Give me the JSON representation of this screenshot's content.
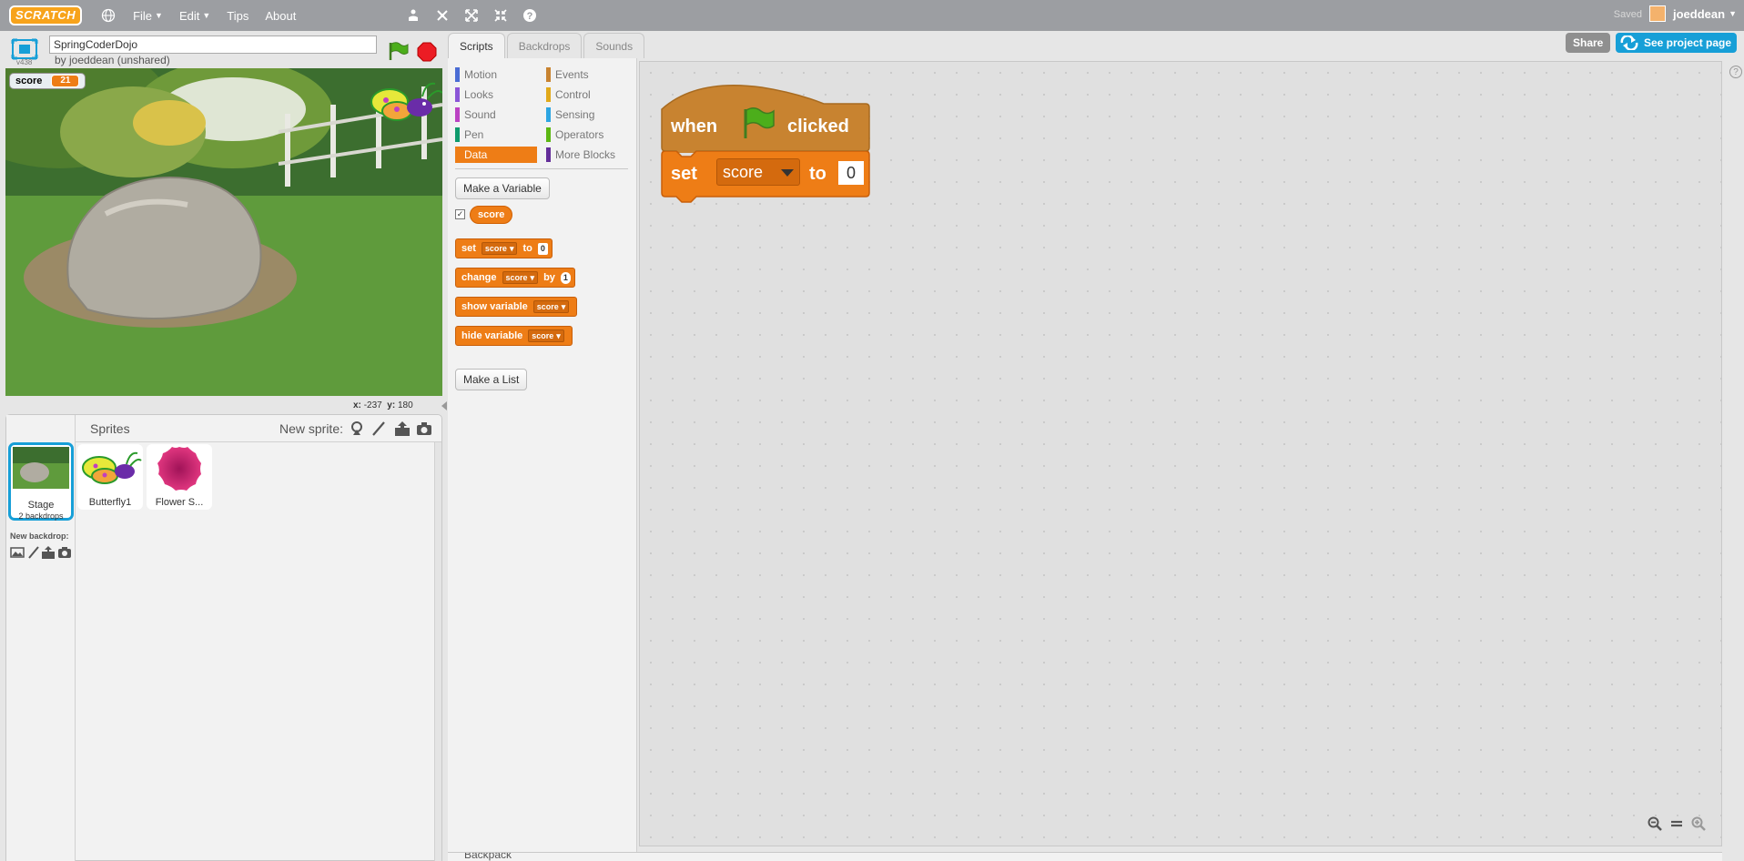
{
  "menubar": {
    "logo": "SCRATCH",
    "menus": [
      {
        "label": "File",
        "dropdown": true
      },
      {
        "label": "Edit",
        "dropdown": true
      },
      {
        "label": "Tips",
        "dropdown": false
      },
      {
        "label": "About",
        "dropdown": false
      }
    ],
    "tools": [
      "duplicate-icon",
      "delete-icon",
      "grow-icon",
      "shrink-icon",
      "help-icon"
    ],
    "save_status": "Saved",
    "username": "joeddean"
  },
  "stage_header": {
    "project_title": "SpringCoderDojo",
    "byline": "by joeddean (unshared)",
    "version": "v438"
  },
  "stage": {
    "monitor": {
      "label": "score",
      "value": "21"
    },
    "mouse_x_label": "x:",
    "mouse_x": "-237",
    "mouse_y_label": "y:",
    "mouse_y": "180"
  },
  "sprites": {
    "title": "Sprites",
    "new_sprite_label": "New sprite:",
    "stage_item": {
      "label": "Stage",
      "sublabel": "2 backdrops"
    },
    "new_backdrop_label": "New backdrop:",
    "items": [
      {
        "name": "Butterfly1"
      },
      {
        "name": "Flower S..."
      }
    ]
  },
  "tabs": [
    {
      "label": "Scripts",
      "active": true
    },
    {
      "label": "Backdrops",
      "active": false
    },
    {
      "label": "Sounds",
      "active": false
    }
  ],
  "palette": {
    "categories": [
      {
        "label": "Motion",
        "color": "#4a6cd4"
      },
      {
        "label": "Events",
        "color": "#c88330"
      },
      {
        "label": "Looks",
        "color": "#8a55d7"
      },
      {
        "label": "Control",
        "color": "#e1a91a"
      },
      {
        "label": "Sound",
        "color": "#bb42c3"
      },
      {
        "label": "Sensing",
        "color": "#2ca5e2"
      },
      {
        "label": "Pen",
        "color": "#0e9a6c"
      },
      {
        "label": "Operators",
        "color": "#5cb712"
      },
      {
        "label": "Data",
        "color": "#ee7d16"
      },
      {
        "label": "More Blocks",
        "color": "#632d99"
      }
    ],
    "active_category": "Data",
    "make_variable": "Make a Variable",
    "variable_name": "score",
    "variable_checked": true,
    "blocks": [
      {
        "parts": [
          "set",
          "score",
          "to",
          "0"
        ]
      },
      {
        "parts": [
          "change",
          "score",
          "by",
          "1"
        ]
      },
      {
        "parts": [
          "show variable",
          "score"
        ]
      },
      {
        "parts": [
          "hide variable",
          "score"
        ]
      }
    ],
    "make_list": "Make a List"
  },
  "script": {
    "hat": {
      "when": "when",
      "clicked": "clicked"
    },
    "set": {
      "set": "set",
      "variable": "score",
      "to": "to",
      "value": "0"
    }
  },
  "share": {
    "share_label": "Share",
    "project_page_label": "See project page"
  },
  "backpack_label": "Backpack",
  "colors": {
    "data": "#ee7d16",
    "events": "#c88330",
    "menubar": "#9c9ea2",
    "accent": "#179fd7"
  }
}
